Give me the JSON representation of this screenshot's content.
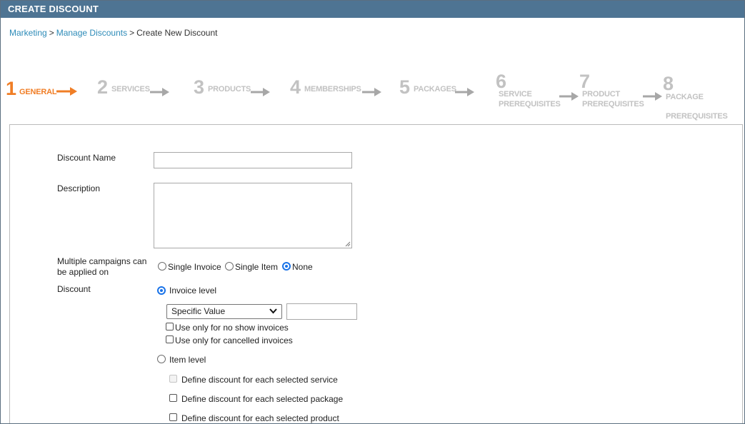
{
  "header": {
    "title": "CREATE DISCOUNT"
  },
  "breadcrumb": {
    "items": [
      "Marketing",
      "Manage Discounts",
      "Create New Discount"
    ],
    "separator": ">"
  },
  "steps": [
    {
      "num": "1",
      "label": "GENERAL",
      "active": true
    },
    {
      "num": "2",
      "label": "SERVICES"
    },
    {
      "num": "3",
      "label": "PRODUCTS"
    },
    {
      "num": "4",
      "label": "MEMBERSHIPS"
    },
    {
      "num": "5",
      "label": "PACKAGES"
    },
    {
      "num": "6",
      "label_line1": "SERVICE",
      "label_line2": "PREREQUISITES"
    },
    {
      "num": "7",
      "label_line1": "PRODUCT",
      "label_line2": "PREREQUISITES"
    },
    {
      "num": "8",
      "label_line1": "PACKAGE",
      "label_line2": "PREREQUISITES"
    }
  ],
  "form": {
    "discount_name_label": "Discount Name",
    "discount_name_value": "",
    "description_label": "Description",
    "description_value": "",
    "multiple_campaigns_label_line1": "Multiple campaigns can",
    "multiple_campaigns_label_line2": "be applied on",
    "multiple_campaigns_options": [
      "Single Invoice",
      "Single Item",
      "None"
    ],
    "multiple_campaigns_selected": "None",
    "discount_label": "Discount",
    "invoice_level_label": "Invoice level",
    "invoice_level_selected": true,
    "value_type_selected": "Specific Value",
    "value_amount": "",
    "no_show_label": "Use only for no show invoices",
    "cancelled_label": "Use only for cancelled invoices",
    "item_level_label": "Item level",
    "item_level_selected": false,
    "item_options": [
      {
        "label": "Define discount for each selected service",
        "disabled": true
      },
      {
        "label": "Define discount for each selected package",
        "disabled": false
      },
      {
        "label": "Define discount for each selected product",
        "disabled": false
      }
    ]
  },
  "colors": {
    "header_bg": "#4e7493",
    "active_step": "#f07e26",
    "inactive_step": "#c2c2c2",
    "link": "#2d8bb8",
    "radio_selected": "#1a73e8"
  }
}
